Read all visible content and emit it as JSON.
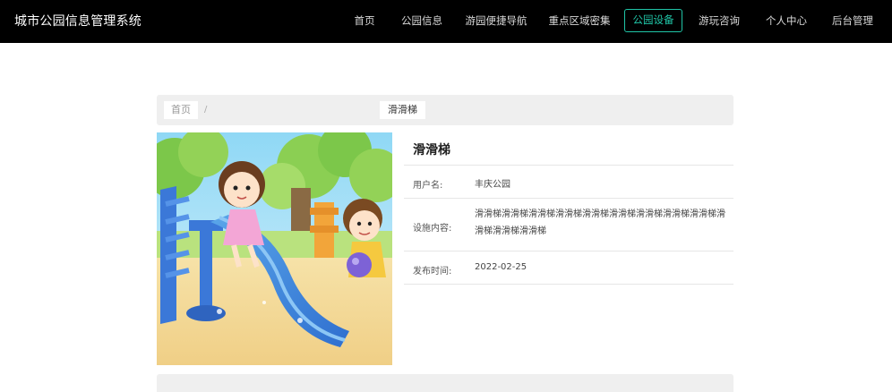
{
  "app": {
    "title": "城市公园信息管理系统"
  },
  "nav": {
    "items": [
      {
        "label": "首页"
      },
      {
        "label": "公园信息"
      },
      {
        "label": "游园便捷导航"
      },
      {
        "label": "重点区域密集"
      },
      {
        "label": "公园设备"
      },
      {
        "label": "游玩咨询"
      },
      {
        "label": "个人中心"
      },
      {
        "label": "后台管理"
      }
    ],
    "active_index": 4,
    "active_color": "#20c5a7"
  },
  "breadcrumb": {
    "home": "首页",
    "separator": "/",
    "current": "滑滑梯"
  },
  "detail": {
    "title": "滑滑梯",
    "image": {
      "subject": "children-on-slide-illustration"
    },
    "fields": [
      {
        "label": "用户名:",
        "value": "丰庆公园"
      },
      {
        "label": "设施内容:",
        "value": "滑滑梯滑滑梯滑滑梯滑滑梯滑滑梯滑滑梯滑滑梯滑滑梯滑滑梯滑滑梯滑滑梯滑滑梯"
      },
      {
        "label": "发布时间:",
        "value": "2022-02-25"
      }
    ]
  }
}
